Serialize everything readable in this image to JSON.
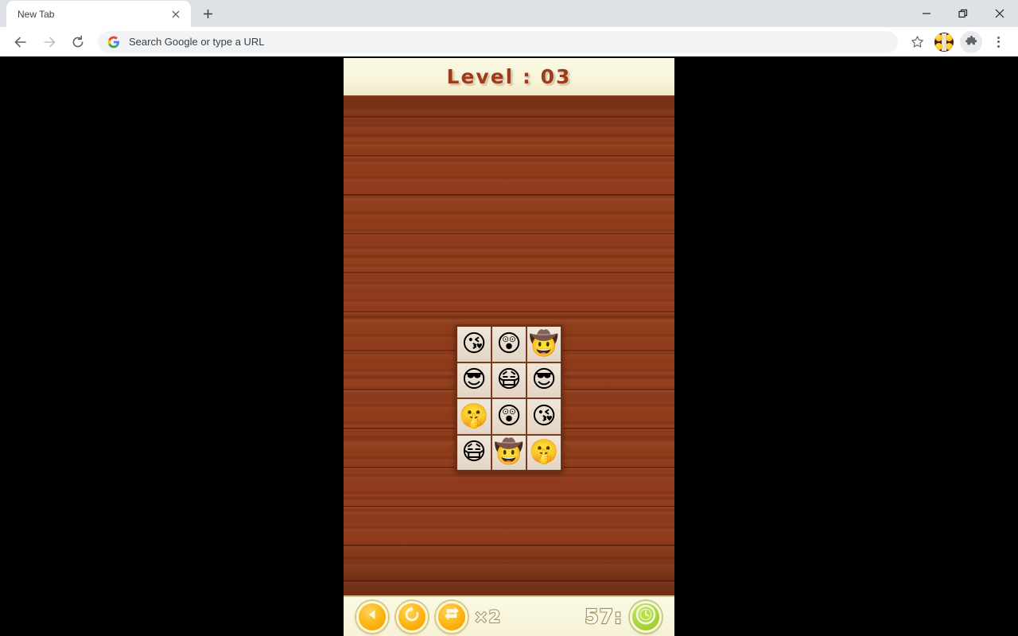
{
  "browser": {
    "tab": {
      "title": "New Tab",
      "close_icon": "close-icon"
    },
    "newtab_label": "+",
    "window_controls": {
      "minimize": "minimize-icon",
      "maximize": "maximize-icon",
      "close": "close-icon"
    },
    "nav": {
      "back": "back-arrow-icon",
      "forward": "forward-arrow-icon",
      "reload": "reload-icon"
    },
    "omnibox": {
      "placeholder": "Search Google or type a URL",
      "value": "",
      "leading_icon": "google-g-icon"
    },
    "actions": {
      "bookmark": "star-icon",
      "extension": "emoji-game-extension-icon",
      "extensions": "puzzle-piece-icon",
      "menu": "three-dot-menu-icon"
    }
  },
  "game": {
    "header": {
      "level_label": "Level : 03"
    },
    "colors": {
      "wood": "#8c3a1a",
      "cream": "#fbf9e4",
      "level_text": "#9e3b18",
      "orange_button": "#fcb410",
      "green_button": "#a9d63a",
      "tile": "#e9ded1"
    },
    "grid": {
      "columns": 3,
      "rows": 4,
      "tiles": [
        {
          "name": "kissing-heart-emoji",
          "glyph": "😘"
        },
        {
          "name": "astonished-face-emoji",
          "glyph": "😲"
        },
        {
          "name": "cowboy-hat-face-emoji",
          "glyph": "🤠"
        },
        {
          "name": "sunglasses-face-emoji",
          "glyph": "😎"
        },
        {
          "name": "medical-mask-face-emoji",
          "glyph": "😷"
        },
        {
          "name": "sunglasses-face-emoji",
          "glyph": "😎"
        },
        {
          "name": "shushing-face-emoji",
          "glyph": "🤫"
        },
        {
          "name": "astonished-face-emoji",
          "glyph": "😲"
        },
        {
          "name": "kissing-heart-emoji",
          "glyph": "😘"
        },
        {
          "name": "medical-mask-face-emoji",
          "glyph": "😷"
        },
        {
          "name": "cowboy-hat-face-emoji",
          "glyph": "🤠"
        },
        {
          "name": "shushing-face-emoji",
          "glyph": "🤫"
        }
      ]
    },
    "footer": {
      "back_button": "back-triangle-icon",
      "restart_button": "restart-circular-arrow-icon",
      "shuffle_button": "shuffle-arrows-icon",
      "shuffle_count": "×2",
      "timer_value": "57:",
      "clock_button": "clock-icon"
    }
  }
}
